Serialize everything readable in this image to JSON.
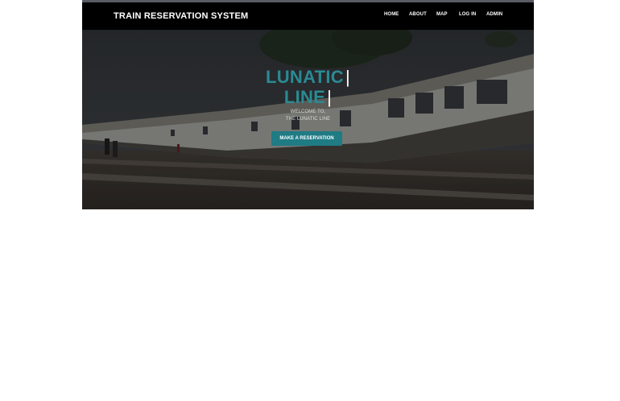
{
  "brand": "TRAIN RESERVATION SYSTEM",
  "nav": {
    "home": "HOME",
    "about": "ABOUT",
    "map": "MAP",
    "login": "LOG IN",
    "admin": "ADMIN"
  },
  "hero": {
    "title_line1": "LUNATIC",
    "title_line2": "LINE",
    "caret": "|",
    "welcome_line1": "WELCOME TO,",
    "welcome_line2": "THE LUNATIC LINE",
    "cta_label": "MAKE A RESERVATION"
  },
  "colors": {
    "navbar": "#000000",
    "title_teal": "#2b8a93",
    "button_teal": "#1f7b84",
    "text_white": "#ffffff"
  }
}
